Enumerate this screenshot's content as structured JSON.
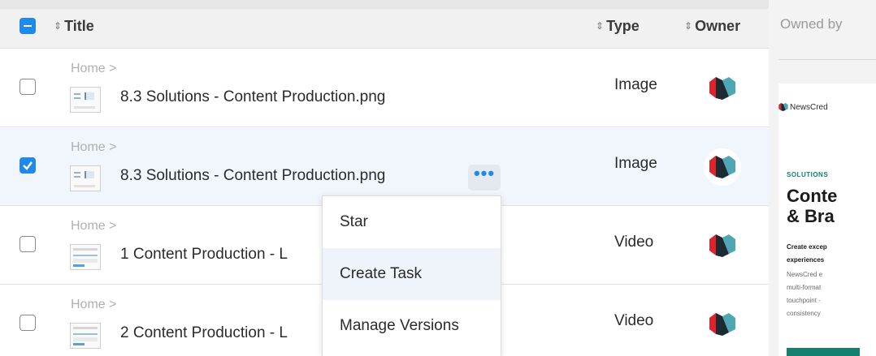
{
  "header": {
    "columns": {
      "title": "Title",
      "type": "Type",
      "owner": "Owner"
    },
    "sort_glyph": "⇕"
  },
  "rows": [
    {
      "breadcrumb": "Home >",
      "filename": "8.3 Solutions - Content Production.png",
      "type": "Image",
      "checked": false
    },
    {
      "breadcrumb": "Home >",
      "filename": "8.3 Solutions - Content Production.png",
      "type": "Image",
      "checked": true
    },
    {
      "breadcrumb": "Home >",
      "filename": "1 Content Production - L",
      "type": "Video",
      "checked": false
    },
    {
      "breadcrumb": "Home >",
      "filename": "2 Content Production - L",
      "type": "Video",
      "checked": false
    }
  ],
  "more_button": {
    "label": "•••"
  },
  "context_menu": {
    "items": [
      "Star",
      "Create Task",
      "Manage Versions"
    ],
    "hovered_item": "Create Task"
  },
  "side_panel": {
    "owned_by": "Owned by",
    "preview": {
      "brand": "NewsCred",
      "section": "SOLUTIONS",
      "title_line1": "Conte",
      "title_line2": "& Bra",
      "subtitle_line1": "Create excep",
      "subtitle_line2": "experiences",
      "body_lines": [
        "NewsCred e",
        "multi-format",
        "touchpoint -",
        "consistency"
      ]
    }
  },
  "colors": {
    "accent": "#1f8ae8",
    "logo_red": "#e0222b",
    "logo_dark": "#1c2b33",
    "logo_teal": "#4fa7b3",
    "preview_green": "#14806f"
  }
}
